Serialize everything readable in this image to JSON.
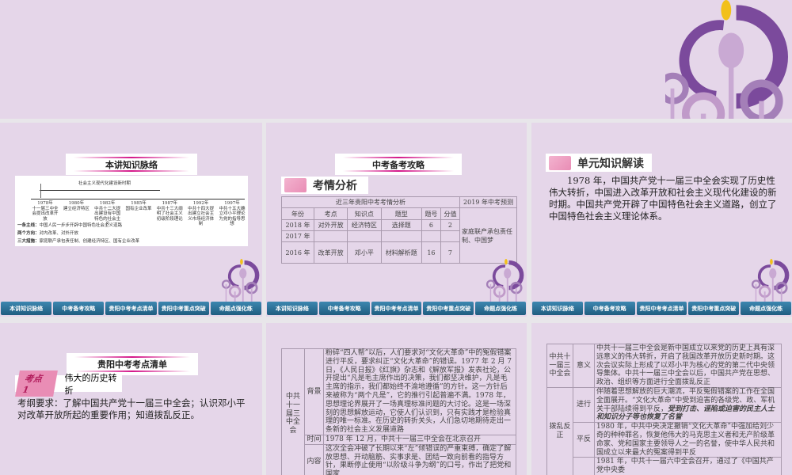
{
  "nav": [
    "本讲知识脉络",
    "中考备考攻略",
    "贵阳中考考点清单",
    "贵阳中考重点突破",
    "命题点强化练"
  ],
  "slide1": {
    "title": "本讲知识脉络",
    "period": "社会主义现代化建设新时期",
    "timeline": [
      {
        "year": "1978年",
        "text": "十一届三中全会提出改革开放"
      },
      {
        "year": "1980年",
        "text": "建立经济特区"
      },
      {
        "year": "1982年",
        "text": "中共十二大提出建设有中国特色的社会主义"
      },
      {
        "year": "1985年",
        "text": "国有企业改革"
      },
      {
        "year": "1987年",
        "text": "中共十三大阐明了社会主义初级阶段理论"
      },
      {
        "year": "1992年",
        "text": "中共十四大提出建立社会主义市场经济体制"
      },
      {
        "year": "1997年",
        "text": "中共十五大确立邓小平理论为党的指导思想"
      }
    ],
    "lines": [
      {
        "k": "一条主线：",
        "v": "中国人民一步步开辟中国特色社会主义道路"
      },
      {
        "k": "两个方向：",
        "v": "对内改革、对外开放"
      },
      {
        "k": "三大措施：",
        "v": "家庭联产承包责任制、创建经济特区、国有企业改革"
      }
    ]
  },
  "slide2": {
    "title": "中考备考攻略",
    "section": "考情分析",
    "table_title": "近三年贵阳中考考情分析",
    "predict_title": "2019 年中考预测",
    "headers": [
      "年份",
      "考点",
      "知识点",
      "题型",
      "题号",
      "分值"
    ],
    "rows": [
      [
        "2018 年",
        "对外开放",
        "经济特区",
        "选择题",
        "6",
        "2"
      ],
      [
        "2017 年",
        "",
        "",
        "",
        "",
        ""
      ],
      [
        "2016 年",
        "改革开放",
        "邓小平",
        "材料解析题",
        "16",
        "7"
      ]
    ],
    "predict": "家庭联产承包责任制、中国梦"
  },
  "slide3": {
    "section": "单元知识解读",
    "text": "1978 年，中国共产党十一届三中全会实现了历史性伟大转折，中国进入改革开放和社会主义现代化建设的新时期。中国共产党开辟了中国特色社会主义道路，创立了中国特色社会主义理论体系。"
  },
  "slide4": {
    "title": "贵阳中考考点清单",
    "tag": "考点 1",
    "topic": "伟大的历史转折",
    "text": "考纲要求：了解中国共产党十一届三中全会；认识邓小平对改革开放所起的重要作用；知道拨乱反正。"
  },
  "slide5": {
    "group": "中共十一届三中全会",
    "rows": [
      {
        "k": "背景",
        "v": "粉碎“四人帮”以后，人们要求对“文化大革命”中的冤假错案进行平反，要求纠正“文化大革命”的错误。1977 年 2 月 7 日，《人民日报》《红旗》杂志和《解放军报》发表社论，公开提出“凡是毛主席作出的决策，我们都坚决维护，凡是毛主席的指示，我们都始终不渝地遵循”的方针。这一方针后来被称为“两个凡是”，它的推行引起普遍不满。1978 年，思想理论界展开了一场真理标准问题的大讨论。这是一场深刻的思想解放运动，它使人们认识到，只有实践才是检验真理的唯一标准。在历史的转折关头，人们急切地期待走出一条新的社会主义发展道路"
      },
      {
        "k": "时间",
        "v": "1978 年 12 月，中共十一届三中全会在北京召开"
      },
      {
        "k": "内容",
        "v": "这次全会冲破了长期以来“左”倾错误的严重束缚，确定了解放思想、开动脑筋、实事求是、团结一致向前看的指导方针，果断停止使用“以阶级斗争为纲”的口号，作出了把党和国家"
      }
    ]
  },
  "slide6": {
    "group1": "中共十一届三中全会",
    "k1": "意义",
    "v1": "中共十一届三中全会是新中国成立以来党的历史上具有深远意义的伟大转折，开启了我国改革开放历史新时期。这次会议实际上形成了以邓小平为核心的党的第二代中央领导集体。中共十一届三中全会以后，中国共产党在思想、政治、组织等方面进行全面拨乱反正",
    "group2": "拨乱反正",
    "k2": "进行",
    "v2a": "伴随着思想解放的巨大潮流，平反冤假错案的工作在全国全面展开。“文化大革命”中受到迫害的各级党、政、军机关干部陆续得到平反，",
    "v2b": "受到打击、诬陷或迫害的民主人士和知识分子等也恢复了名誉",
    "k3": "平反",
    "v3": "1980 年，中共中央决定撤销“文化大革命”中强加给刘少奇的种种罪名，恢复他伟大的马克思主义者和无产阶级革命家、党和国家主要领导人之一的名誉，使中华人民共和国成立以来最大的冤案得到平反",
    "v4": "1981 年，中共十一届六中全会召开，通过了《中国共产党中央委"
  }
}
